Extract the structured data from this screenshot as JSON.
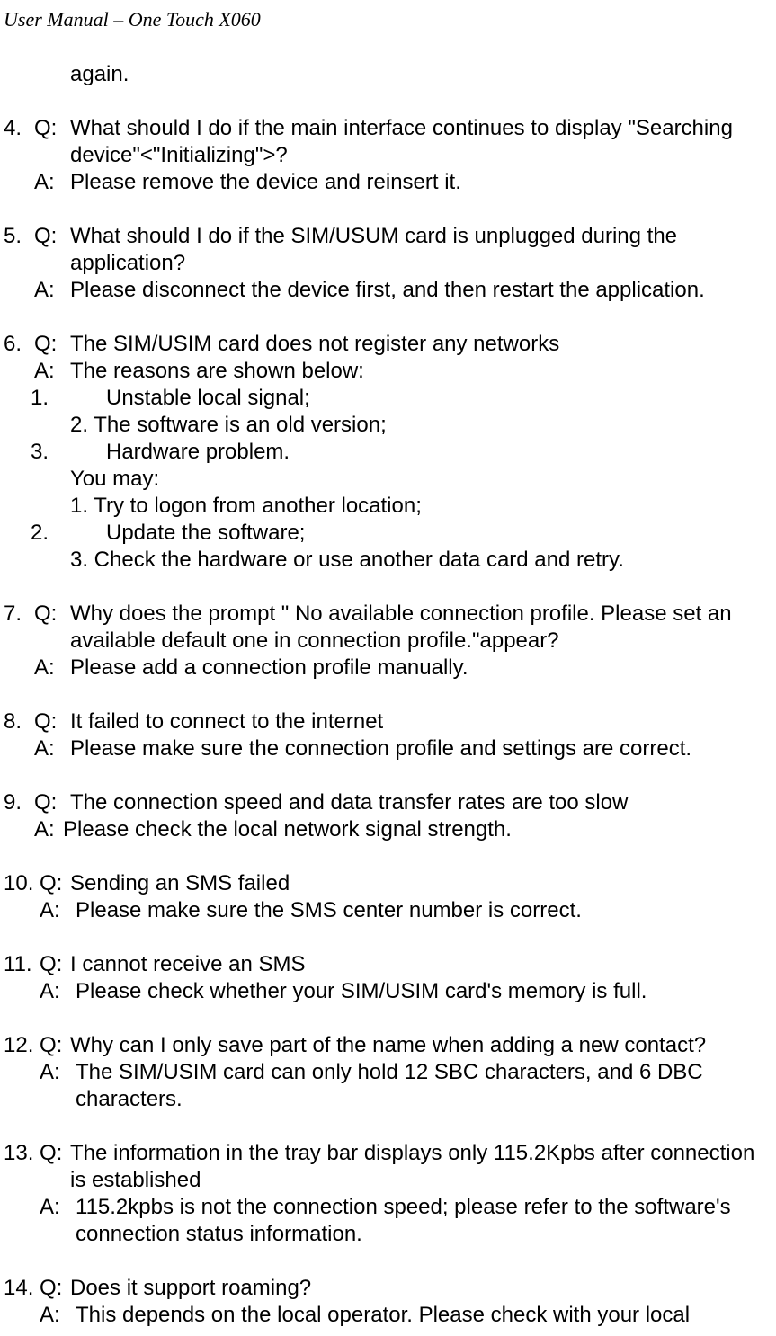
{
  "header": "User Manual – One Touch X060",
  "cont": "again.",
  "items": [
    {
      "n": "4.",
      "q": "What should I do if the main interface continues to display \"Searching device\"<\"Initializing\">?",
      "a": "Please remove the device and reinsert it."
    },
    {
      "n": "5.",
      "q": "What should I do if the SIM/USUM card is unplugged during the application?",
      "a": "Please disconnect the device first, and then restart the application."
    },
    {
      "n": "6.",
      "q": "The SIM/USIM card does not register any networks",
      "a": "The reasons are shown below:",
      "sub_a": [
        "Unstable local signal;",
        "2. The software is an old version;",
        "Hardware problem."
      ],
      "sub_a_nums": [
        "1.",
        "",
        "3."
      ],
      "mid": "You may:",
      "sub_b": [
        "1. Try to logon from another location;",
        "Update the software;",
        "3. Check the hardware or use another data card and retry."
      ],
      "sub_b_nums": [
        "",
        "2.",
        ""
      ]
    },
    {
      "n": "7.",
      "q": "Why does the prompt \" No available connection profile. Please set an available default one in connection profile.\"appear?",
      "a": "Please add a connection profile manually."
    },
    {
      "n": "8.",
      "q": "It failed to connect to the internet",
      "a": "Please make sure the connection profile and settings are correct."
    },
    {
      "n": "9.",
      "q": "The connection speed and data transfer rates are too slow",
      "a": "Please check the local network signal strength.",
      "atight": true
    },
    {
      "n": "10.",
      "q": "Sending an SMS failed",
      "a": "Please make sure the SMS center number is correct.",
      "wide": true,
      "qtight": true
    },
    {
      "n": "11.",
      "q": "I cannot receive an SMS",
      "a": "Please check whether your SIM/USIM card's memory is full.",
      "wide": true,
      "qtight": true
    },
    {
      "n": "12.",
      "q": "Why can I only save part of the name when adding a new contact?",
      "a": "The SIM/USIM card can only hold 12 SBC characters, and 6 DBC characters.",
      "wide": true,
      "qtight": true
    },
    {
      "n": "13.",
      "q": "The information in the tray bar displays only 115.2Kpbs after connection is established",
      "a": "115.2kpbs is not the connection speed; please refer to the software's connection status information.",
      "wide": true,
      "qtight": true
    },
    {
      "n": "14.",
      "q": "Does it support roaming?",
      "a": "This depends on the local operator. Please check with your local",
      "wide": true,
      "qtight": true,
      "last": true
    }
  ],
  "labels": {
    "Q": "Q:",
    "A": "A:"
  }
}
